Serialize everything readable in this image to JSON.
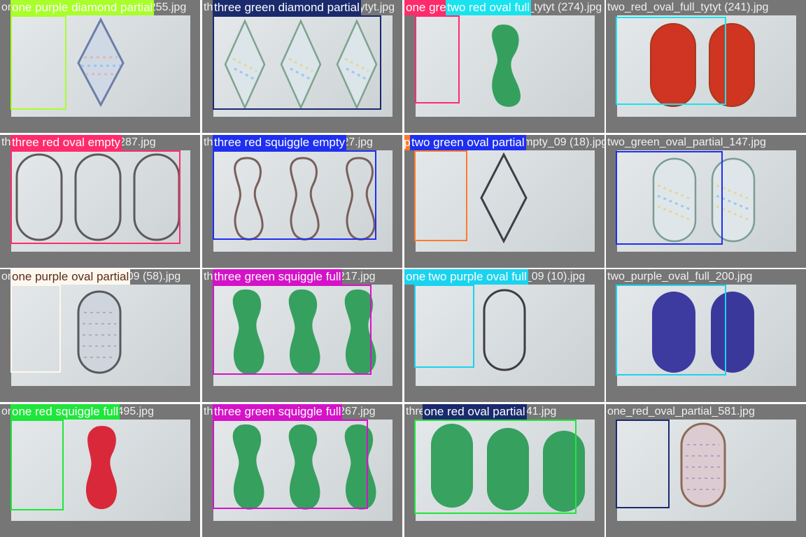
{
  "tiles": [
    {
      "filename": "one_purple_diamond_partial_255.jpg",
      "detections": [
        {
          "label": "one purple diamond partial",
          "color": "#a8ff2a"
        }
      ]
    },
    {
      "filename": "three_green_diamond_partial_tytyt.jpg",
      "detections": [
        {
          "label": "three green diamond partial",
          "color": "#1a2a6c"
        }
      ]
    },
    {
      "filename": "one_green_squiggle_full_tytyt (274).jpg",
      "detections": [
        {
          "label": "one gre",
          "color": "#ff2b6b"
        },
        {
          "label": "two red oval full",
          "color": "#19e3ee"
        }
      ]
    },
    {
      "filename": "two_red_oval_full_tytyt (241).jpg",
      "detections": [
        {
          "label": "",
          "color": "#19e3ee"
        }
      ]
    },
    {
      "filename": "three_red_oval_empty_287.jpg",
      "detections": [
        {
          "label": "three red oval empty",
          "color": "#ff2b6b"
        }
      ]
    },
    {
      "filename": "three_red_squiggle_empty_27.jpg",
      "detections": [
        {
          "label": "three red squiggle empty",
          "color": "#1e2ff0"
        }
      ]
    },
    {
      "filename": "one_purple_diamond_empty_09 (18).jpg",
      "detections": [
        {
          "label": "one p",
          "color": "#ff7a2b"
        },
        {
          "label": "two green oval partial",
          "color": "#1e2ff0"
        }
      ]
    },
    {
      "filename": "two_green_oval_partial_147.jpg",
      "detections": [
        {
          "label": "",
          "color": "#1e2ff0"
        }
      ]
    },
    {
      "filename": "one_purple_oval_partial_09 (58).jpg",
      "detections": [
        {
          "label": "one purple oval partial",
          "color": "#fdf8ee"
        }
      ]
    },
    {
      "filename": "three_green_squiggle_full_217.jpg",
      "detections": [
        {
          "label": "three green squiggle full",
          "color": "#d512c8"
        }
      ]
    },
    {
      "filename": "one_purple_oval_empty_09 (10).jpg",
      "detections": [
        {
          "label": "one",
          "color": "#1ad3ee"
        },
        {
          "label": "two purple oval full",
          "color": "#1ad3ee"
        }
      ]
    },
    {
      "filename": "two_purple_oval_full_200.jpg",
      "detections": [
        {
          "label": "",
          "color": "#1ad3ee"
        }
      ]
    },
    {
      "filename": "one_red_squiggle_full_495.jpg",
      "detections": [
        {
          "label": "one red squiggle full",
          "color": "#1ee63a"
        }
      ]
    },
    {
      "filename": "three_green_squiggle_full_267.jpg",
      "detections": [
        {
          "label": "three green squiggle full",
          "color": "#d512c8"
        }
      ]
    },
    {
      "filename": "three_green_oval_full_241.jpg",
      "detections": [
        {
          "label": "",
          "color": "#1ee63a"
        },
        {
          "label": "one red oval partial",
          "color": "#1a2a6c"
        }
      ]
    },
    {
      "filename": "one_red_oval_partial_581.jpg",
      "detections": [
        {
          "label": "",
          "color": "#1a2a6c"
        }
      ]
    }
  ]
}
